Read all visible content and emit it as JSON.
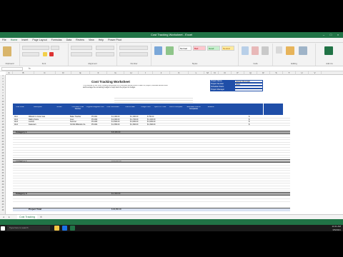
{
  "window": {
    "title": "Cost Tracking Worksheet - Excel"
  },
  "tabs": [
    "File",
    "Home",
    "Insert",
    "Page Layout",
    "Formulas",
    "Data",
    "Review",
    "View",
    "Help",
    "Power Pivot"
  ],
  "active_tab": "Home",
  "ribbon": {
    "groups": [
      "Clipboard",
      "Font",
      "Alignment",
      "Number",
      "Styles",
      "Cells",
      "Editing",
      "Add-ins"
    ],
    "styles": [
      "Normal",
      "Bad",
      "Good",
      "Neutral"
    ]
  },
  "formula_bar": {
    "name_box": "",
    "fx": "fx"
  },
  "worksheet": {
    "title": "Cost Tracking Worksheet",
    "intro": "The purpose of the Cost Tracking Worksheet is to compare actual costs to date for project, estimate actual costs and leverage the remaining budget to help track the project to budget.",
    "project_labels": [
      "Project Name",
      "Project Number",
      "Schedule Starts",
      "Project Manager"
    ],
    "project_values": [
      "Kitchen Remodel",
      "2019",
      "",
      ""
    ],
    "headers": [
      "Cost Code",
      "Description",
      "Vendor",
      "Purchase Order Number",
      "Original Budgeted Cost",
      "Cost Committed",
      "Cost to Date",
      "Freight Over",
      "Open P.O. Cost",
      "Cost to Complete",
      "Estimated Cost at Completion",
      "Variance"
    ],
    "rows": [
      {
        "code": "1111",
        "desc": "Millwork to Code Vela",
        "vendor": "Baker Heather",
        "po": "PO-001",
        "budget": "$   1,000.00",
        "committed": "$   1,000.00",
        "todate": "$   750.00",
        "variance": "$"
      },
      {
        "code": "1112",
        "desc": "Railing Scare",
        "vendor": "Aves",
        "po": "PO-002",
        "budget": "$   2,000.00",
        "committed": "$   1,700.00",
        "todate": "$   1,400.00",
        "variance": "$"
      },
      {
        "code": "1113",
        "desc": "Lumber",
        "vendor": "Summer",
        "po": "PO-003",
        "budget": "$   3,500.00",
        "committed": "$   3,450.00",
        "todate": "$   3,450.00",
        "variance": "$"
      },
      {
        "code": "1114",
        "desc": "Fasteners",
        "vendor": "Orchid Millworks Co.",
        "po": "PO-004",
        "budget": "$   1,650.00",
        "committed": "$   1,600.00",
        "todate": "$   1,600.00",
        "variance": "$"
      }
    ],
    "category_labels": [
      "Category 1",
      "Category 2",
      "Category 3"
    ],
    "category_totals": [
      "$  8,150.00",
      "$  24,000.00",
      "$  1,500.00"
    ],
    "project_total_label": "Project Total",
    "project_total": "$  30,650.00"
  },
  "sheet_tab": "Cost Tracking",
  "taskbar": {
    "search": "Type here to search",
    "time": "11:01 AM",
    "date": "3/5/2021"
  },
  "colors": {
    "excel_green": "#217346",
    "header_blue": "#1f4ea8",
    "category_gray": "#a6a6a6"
  }
}
